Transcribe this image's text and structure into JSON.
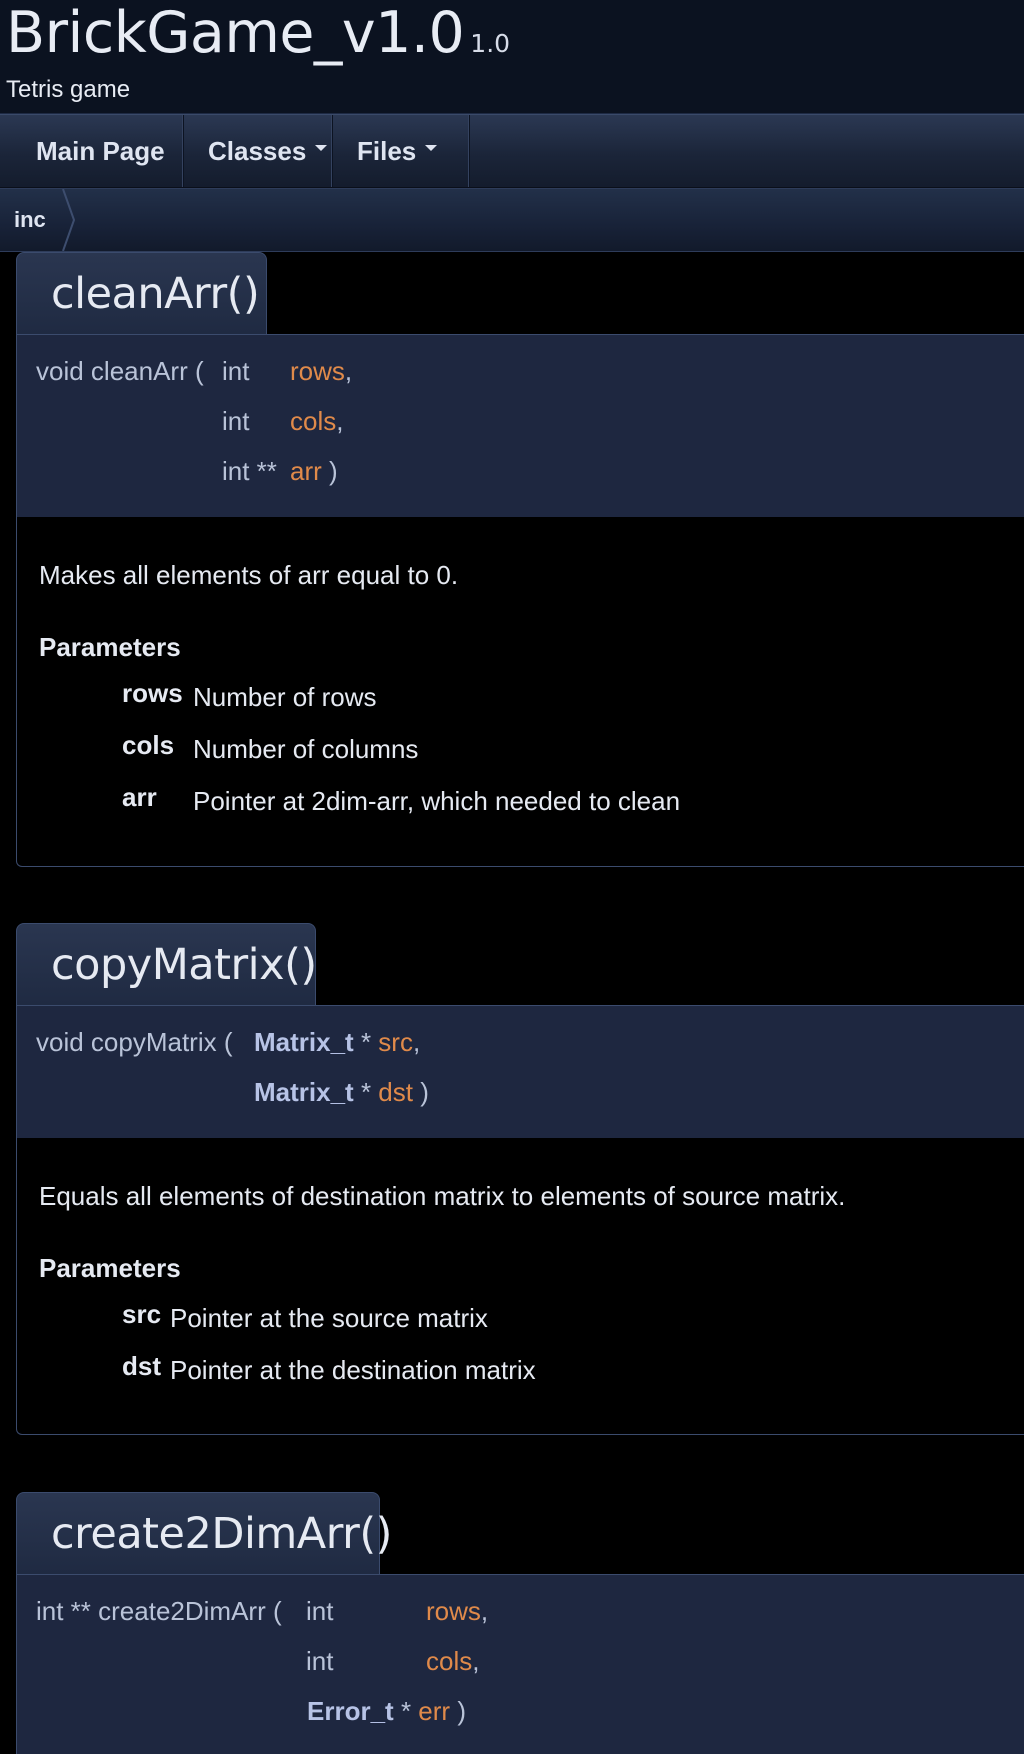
{
  "header": {
    "project_name": "BrickGame_v1.0",
    "project_number": "1.0",
    "project_brief": "Tetris game"
  },
  "nav": {
    "main_page": "Main Page",
    "classes": "Classes",
    "files": "Files"
  },
  "breadcrumb": {
    "item": "inc"
  },
  "members": [
    {
      "title": "cleanArr()",
      "proto": {
        "prefix": "void cleanArr (",
        "rows": [
          {
            "type": "int",
            "name": "rows",
            "sep": ","
          },
          {
            "type": "int",
            "name": "cols",
            "sep": ","
          },
          {
            "type": "int **",
            "name": "arr",
            "sep": ")"
          }
        ]
      },
      "description": "Makes all elements of arr equal to 0.",
      "params_title": "Parameters",
      "params": [
        {
          "name": "rows",
          "desc": "Number of rows"
        },
        {
          "name": "cols",
          "desc": "Number of columns"
        },
        {
          "name": "arr",
          "desc": "Pointer at 2dim-arr, which needed to clean"
        }
      ]
    },
    {
      "title": "copyMatrix()",
      "proto": {
        "prefix": "void copyMatrix (",
        "rows": [
          {
            "type": "Matrix_t",
            "ptr": "*",
            "name": "src",
            "sep": ","
          },
          {
            "type": "Matrix_t",
            "ptr": "*",
            "name": "dst",
            "sep": ")"
          }
        ]
      },
      "description": "Equals all elements of destination matrix to elements of source matrix.",
      "params_title": "Parameters",
      "params": [
        {
          "name": "src",
          "desc": "Pointer at the source matrix"
        },
        {
          "name": "dst",
          "desc": "Pointer at the destination matrix"
        }
      ]
    },
    {
      "title": "create2DimArr()",
      "proto": {
        "prefix": "int ** create2DimArr (",
        "rows": [
          {
            "type": "int",
            "name": "rows",
            "sep": ","
          },
          {
            "type": "int",
            "name": "cols",
            "sep": ","
          },
          {
            "type": "Error_t",
            "ptr": "*",
            "name": "err",
            "sep": ")"
          }
        ]
      }
    }
  ]
}
